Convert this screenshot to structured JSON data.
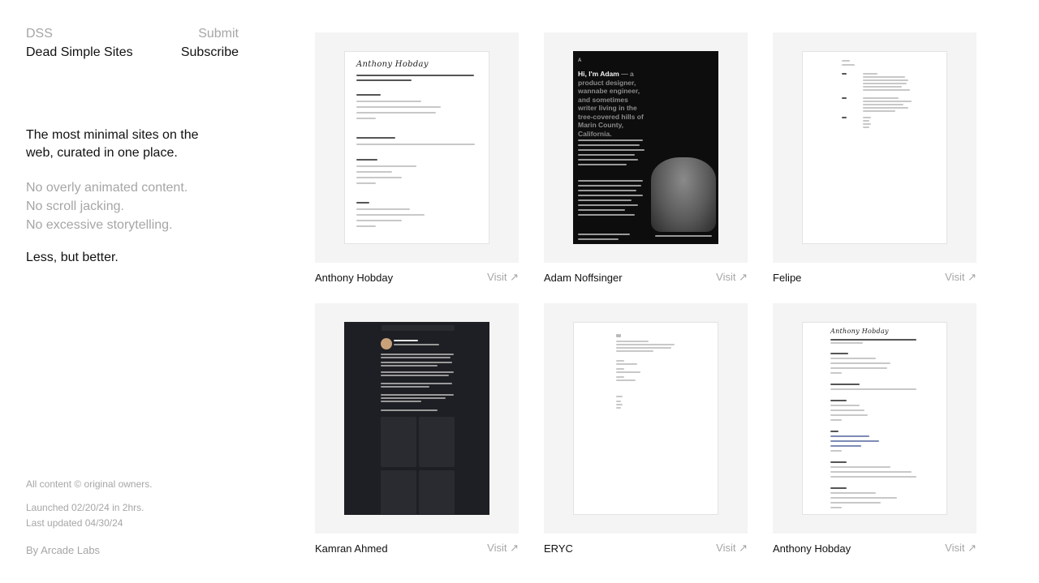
{
  "brand": {
    "short": "DSS",
    "name": "Dead Simple Sites",
    "submit": "Submit",
    "subscribe": "Subscribe"
  },
  "intro": {
    "tagline": "The most minimal sites on the web, curated in one place.",
    "negatives": [
      "No overly animated content.",
      "No scroll jacking.",
      "No excessive storytelling."
    ],
    "motto": "Less, but better."
  },
  "footer": {
    "copyright": "All content © original owners.",
    "launched": "Launched 02/20/24 in 2hrs.",
    "updated": "Last updated 04/30/24",
    "by": "By Arcade Labs"
  },
  "cards": [
    {
      "title": "Anthony Hobday",
      "visit": "Visit ↗"
    },
    {
      "title": "Adam Noffsinger",
      "visit": "Visit ↗"
    },
    {
      "title": "Felipe",
      "visit": "Visit ↗"
    },
    {
      "title": "Kamran Ahmed",
      "visit": "Visit ↗"
    },
    {
      "title": "ERYC",
      "visit": "Visit ↗"
    },
    {
      "title": "Anthony Hobday",
      "visit": "Visit ↗"
    }
  ],
  "previews": {
    "hobday_signature": "Anthony Hobday",
    "adam_hero_lead": "Hi, I'm Adam",
    "adam_hero_rest": " — a product designer, wannabe engineer, and sometimes writer living in the tree-covered hills of Marin County, California.",
    "adam_logo": "A"
  },
  "colors": {
    "thumb_bg": "#f4f4f4",
    "muted_text": "#a6a6a6",
    "text": "#111111"
  }
}
